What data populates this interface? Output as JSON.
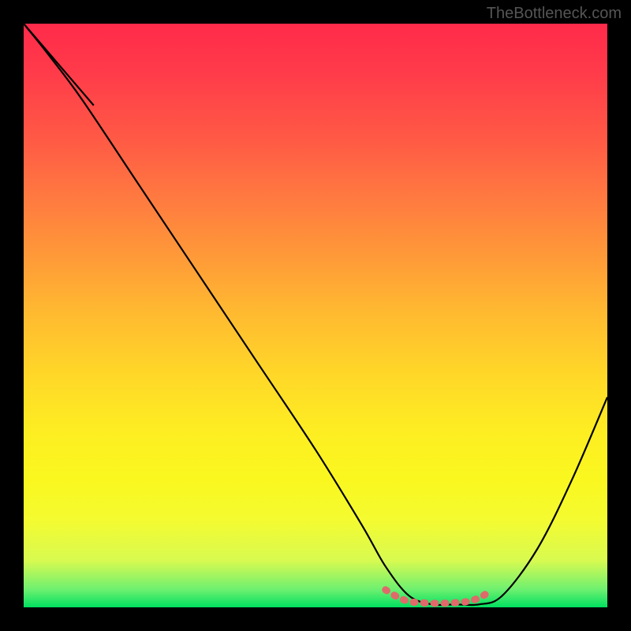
{
  "attribution": "TheBottleneck.com",
  "chart_data": {
    "type": "line",
    "title": "",
    "xlabel": "",
    "ylabel": "",
    "xlim": [
      0,
      100
    ],
    "ylim": [
      0,
      100
    ],
    "series": [
      {
        "name": "curve",
        "x": [
          0,
          4,
          10,
          20,
          30,
          40,
          50,
          58,
          62,
          66,
          70,
          74,
          78,
          82,
          88,
          94,
          100
        ],
        "y": [
          100,
          95,
          87,
          72,
          57,
          42,
          27,
          14,
          7,
          2,
          0.5,
          0.5,
          0.5,
          2,
          10,
          22,
          36
        ]
      }
    ],
    "highlight": {
      "name": "trough-marker",
      "color": "#e06a6a",
      "x": [
        62,
        64,
        66,
        68,
        70,
        72,
        74,
        76,
        78,
        80
      ],
      "y": [
        3,
        1.8,
        1,
        0.8,
        0.7,
        0.7,
        0.8,
        1,
        1.6,
        2.8
      ]
    },
    "alt_curve_visible": true,
    "alt_curve": {
      "x": [
        0,
        6,
        12
      ],
      "y": [
        100,
        93,
        86
      ]
    }
  }
}
